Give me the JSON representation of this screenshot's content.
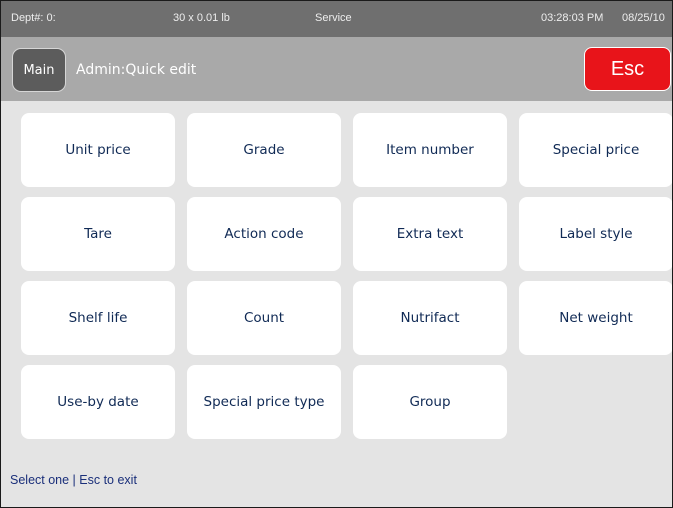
{
  "status_bar": {
    "dept": "Dept#: 0:",
    "capacity": "30 x 0.01 lb",
    "mode": "Service",
    "time": "03:28:03 PM",
    "date": "08/25/10"
  },
  "header": {
    "main_label": "Main",
    "title": "Admin:Quick edit",
    "esc_label": "Esc"
  },
  "options": [
    "Unit price",
    "Grade",
    "Item number",
    "Special price",
    "Tare",
    "Action code",
    "Extra text",
    "Label style",
    "Shelf life",
    "Count",
    "Nutrifact",
    "Net weight",
    "Use-by date",
    "Special price type",
    "Group"
  ],
  "footer": {
    "hint": "Select one | Esc to exit"
  },
  "colors": {
    "status_bar_bg": "#6f6f6f",
    "title_bar_bg": "#a9a9a9",
    "esc_bg": "#e8141a",
    "panel_bg": "#e4e4e4",
    "button_text": "#102a55"
  }
}
